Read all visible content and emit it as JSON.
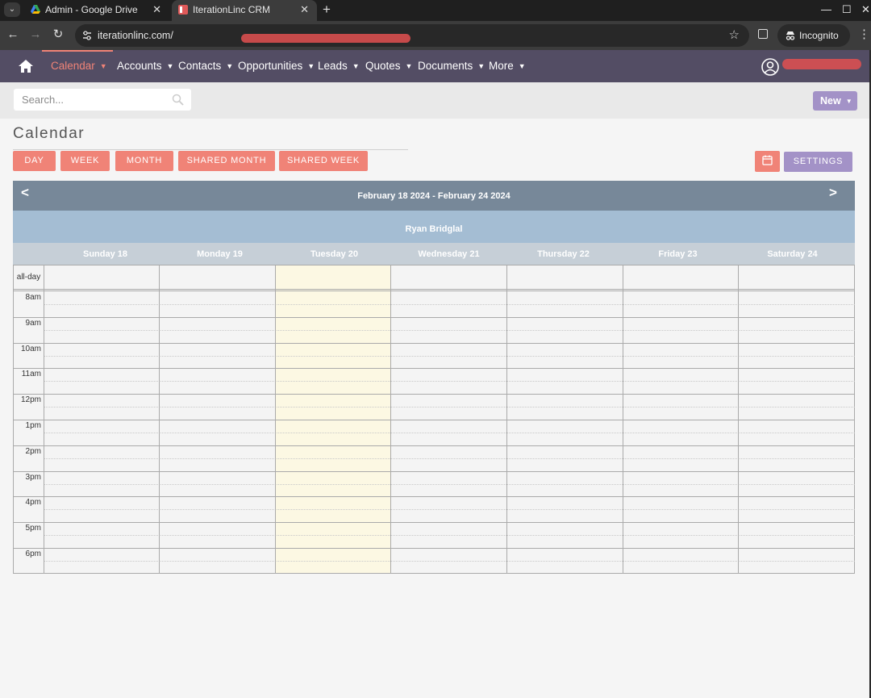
{
  "browser": {
    "tabs": [
      {
        "title": "Admin - Google Drive",
        "icon": "google-drive-icon"
      },
      {
        "title": "IterationLinc CRM",
        "icon": "crm-favicon"
      }
    ],
    "url": "iterationlinc.com/",
    "mode": "Incognito"
  },
  "nav": {
    "items": [
      {
        "label": "Calendar",
        "active": true
      },
      {
        "label": "Accounts"
      },
      {
        "label": "Contacts"
      },
      {
        "label": "Opportunities"
      },
      {
        "label": "Leads"
      },
      {
        "label": "Quotes"
      },
      {
        "label": "Documents"
      },
      {
        "label": "More"
      }
    ]
  },
  "search": {
    "placeholder": "Search..."
  },
  "new_button": "New",
  "page": {
    "title": "Calendar"
  },
  "views": [
    "DAY",
    "WEEK",
    "MONTH",
    "SHARED MONTH",
    "SHARED WEEK"
  ],
  "settings_button": "SETTINGS",
  "calendar": {
    "range": "February 18 2024 - February 24 2024",
    "user": "Ryan Bridglal",
    "days": [
      "Sunday 18",
      "Monday 19",
      "Tuesday 20",
      "Wednesday 21",
      "Thursday 22",
      "Friday 23",
      "Saturday 24"
    ],
    "today": "Tuesday 20",
    "allday_label": "all-day",
    "hours": [
      "8am",
      "9am",
      "10am",
      "11am",
      "12pm",
      "1pm",
      "2pm",
      "3pm",
      "4pm",
      "5pm",
      "6pm"
    ]
  },
  "colors": {
    "nav_bg": "#534d64",
    "accent": "#f08377",
    "secondary": "#a392c7",
    "today_bg": "#fcf8e3",
    "header_bg": "#778899"
  }
}
